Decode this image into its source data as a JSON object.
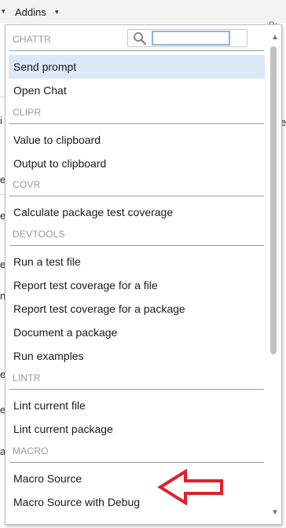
{
  "toolbar": {
    "addins_label": "Addins",
    "left_fragment_caret": "▾",
    "addins_caret": "▾",
    "right_fragment": "Rı"
  },
  "background": {
    "fragments": [
      "i",
      "e",
      "e",
      "e",
      "e",
      "n",
      "e",
      "a",
      "e",
      "a"
    ]
  },
  "search": {
    "placeholder": "",
    "value": ""
  },
  "menu": {
    "sections": [
      {
        "name": "CHATTR",
        "items": [
          "Send prompt",
          "Open Chat"
        ]
      },
      {
        "name": "CLIPR",
        "items": [
          "Value to clipboard",
          "Output to clipboard"
        ]
      },
      {
        "name": "COVR",
        "items": [
          "Calculate package test coverage"
        ]
      },
      {
        "name": "DEVTOOLS",
        "items": [
          "Run a test file",
          "Report test coverage for a file",
          "Report test coverage for a package",
          "Document a package",
          "Run examples"
        ]
      },
      {
        "name": "LINTR",
        "items": [
          "Lint current file",
          "Lint current package"
        ]
      },
      {
        "name": "MACRO",
        "items": [
          "Macro Source",
          "Macro Source with Debug"
        ]
      }
    ],
    "selected_item": "Send prompt"
  },
  "annotation": {
    "arrow_color": "#e0202a",
    "arrow_target": "Macro Source"
  },
  "colors": {
    "selected_bg": "#dbe8f5",
    "section_text": "#9a9a9a",
    "search_focus": "#90b4dc"
  }
}
